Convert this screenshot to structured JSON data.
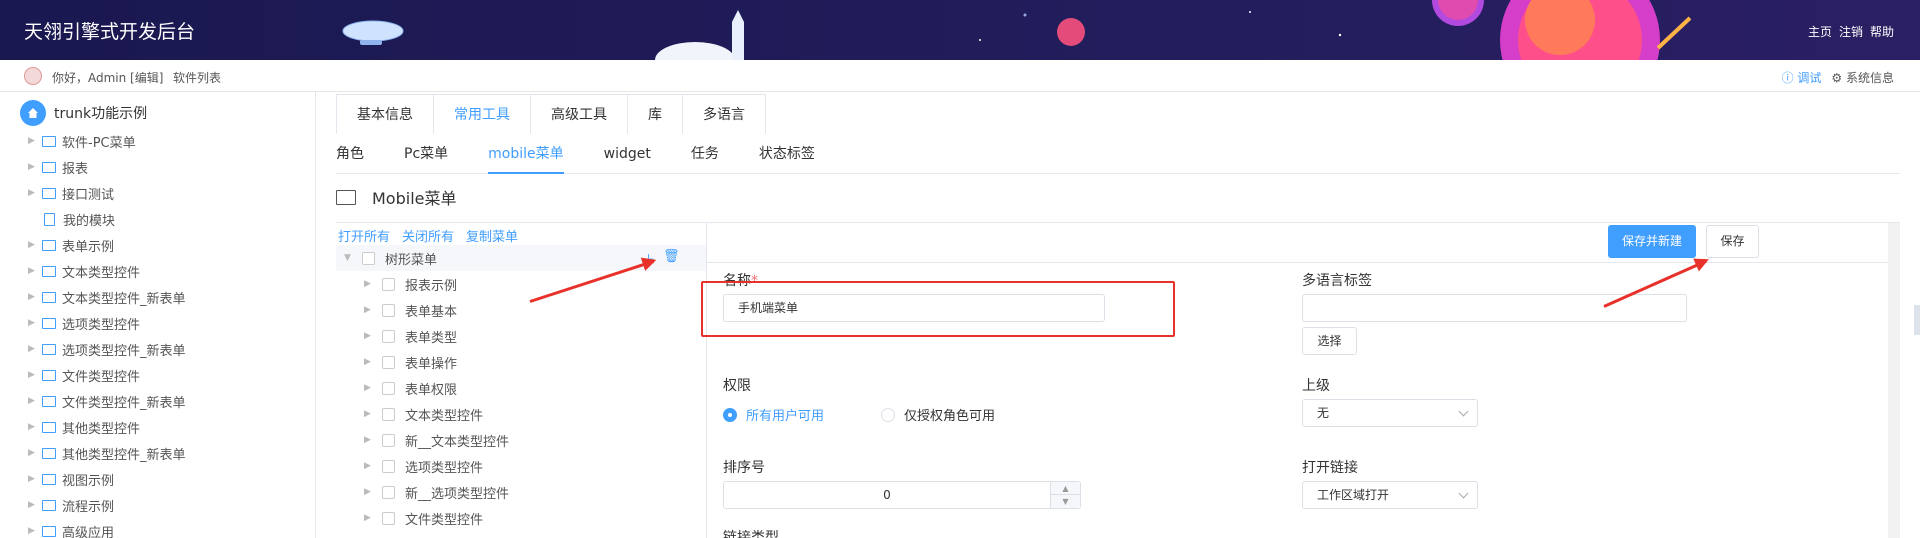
{
  "header": {
    "title": "天翎引擎式开发后台",
    "links": [
      "主页",
      "注销",
      "帮助"
    ]
  },
  "subbar": {
    "greeting": "你好，Admin [编辑]",
    "software_list": "软件列表",
    "debug": "调试",
    "system_info": "系统信息"
  },
  "sidebar": {
    "root": "trunk功能示例",
    "items": [
      "软件-PC菜单",
      "报表",
      "接口测试",
      "我的模块",
      "表单示例",
      "文本类型控件",
      "文本类型控件_新表单",
      "选项类型控件",
      "选项类型控件_新表单",
      "文件类型控件",
      "文件类型控件_新表单",
      "其他类型控件",
      "其他类型控件_新表单",
      "视图示例",
      "流程示例",
      "高级应用"
    ]
  },
  "tabs_primary": [
    "基本信息",
    "常用工具",
    "高级工具",
    "库",
    "多语言"
  ],
  "tabs_secondary": [
    "角色",
    "Pc菜单",
    "mobile菜单",
    "widget",
    "任务",
    "状态标签"
  ],
  "section_title": "Mobile菜单",
  "tree": {
    "actions": [
      "打开所有",
      "关闭所有",
      "复制菜单"
    ],
    "root": "树形菜单",
    "children": [
      "报表示例",
      "表单基本",
      "表单类型",
      "表单操作",
      "表单权限",
      "文本类型控件",
      "新__文本类型控件",
      "选项类型控件",
      "新__选项类型控件",
      "文件类型控件"
    ]
  },
  "form": {
    "save_new_label": "保存并新建",
    "save_label": "保存",
    "name_label": "名称",
    "required_mark": "*",
    "name_value": "手机端菜单",
    "i18n_label": "多语言标签",
    "i18n_value": "",
    "select_button": "选择",
    "permission_label": "权限",
    "permission_options": [
      "所有用户可用",
      "仅授权角色可用"
    ],
    "parent_label": "上级",
    "parent_value": "无",
    "order_label": "排序号",
    "order_value": "0",
    "open_link_label": "打开链接",
    "open_link_value": "工作区域打开",
    "link_type_label": "链接类型"
  },
  "colors": {
    "accent": "#409eff",
    "header_bg": "#1a1850",
    "annotation": "#e8312a"
  }
}
